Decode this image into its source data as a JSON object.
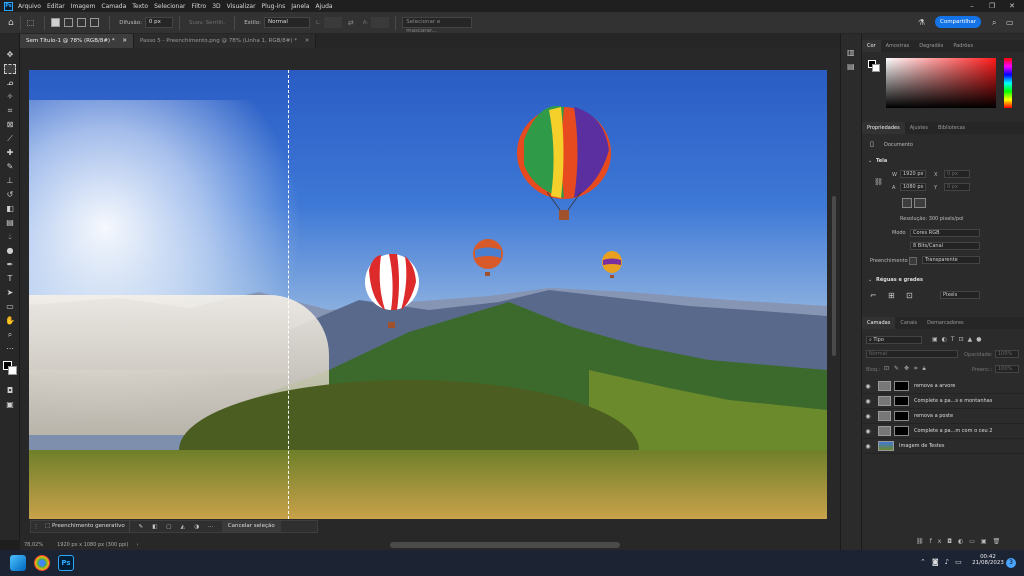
{
  "app": {
    "logo": "Ps",
    "menu": [
      "Arquivo",
      "Editar",
      "Imagem",
      "Camada",
      "Texto",
      "Selecionar",
      "Filtro",
      "3D",
      "Visualizar",
      "Plug-ins",
      "Janela",
      "Ajuda"
    ]
  },
  "options": {
    "difusao_label": "Difusão:",
    "difusao_value": "0 px",
    "suav_label": "Suav. Serrilh.",
    "estilo_label": "Estilo:",
    "estilo_value": "Normal",
    "l_label": "L:",
    "a_label": "A:",
    "select_mask_label": "Selecionar e mascarar...",
    "share_label": "Compartilhar"
  },
  "tabs": [
    {
      "label": "Sem Título-1 @ 78% (RGB/8#) *"
    },
    {
      "label": "Passo 5 - Preenchimento.png @ 78% (Linha 1, RGB/8#) *"
    }
  ],
  "canvas": {
    "context_bar": {
      "generative_fill_label": "Preenchimento generativo",
      "cancel_label": "Cancelar seleção"
    }
  },
  "status": {
    "zoom": "78,02%",
    "doc_info": "1920 px x 1080 px (300 ppi)"
  },
  "color_panel": {
    "tabs": [
      "Cor",
      "Amostras",
      "Degradês",
      "Padrões"
    ]
  },
  "properties": {
    "tabs": [
      "Propriedades",
      "Ajustes",
      "Bibliotecas"
    ],
    "doc_label": "Documento",
    "tela_label": "Tela",
    "w_label": "W",
    "w_value": "1920 px",
    "x_label": "X",
    "x_value": "0 px",
    "h_label": "A",
    "h_value": "1080 px",
    "y_label": "Y",
    "y_value": "0 px",
    "resolution": "Resolução: 300 pixels/pol",
    "mode_label": "Modo",
    "mode_value": "Cores RGB",
    "bits_value": "8 Bits/Canal",
    "fill_label": "Preenchimento",
    "fill_value": "Transparente",
    "rulers_label": "Réguas e grades",
    "units_value": "Pixels"
  },
  "layers": {
    "tabs": [
      "Camadas",
      "Canais",
      "Demarcadores"
    ],
    "filter_value": "Tipo",
    "blend_value": "Normal",
    "opacity_label": "Opacidade:",
    "opacity_value": "100%",
    "lock_label": "Bloq.:",
    "fill_label": "Preenc.:",
    "fill_value": "100%",
    "items": [
      {
        "name": "remova a arvore"
      },
      {
        "name": "Complete a pa...s e montanhas"
      },
      {
        "name": "remova a poste"
      },
      {
        "name": "Complete a pa...m com o ceu 2"
      },
      {
        "name": "Imagem de Testes"
      }
    ]
  },
  "taskbar": {
    "time": "00:42",
    "date": "21/08/2023",
    "notification_count": "3"
  }
}
